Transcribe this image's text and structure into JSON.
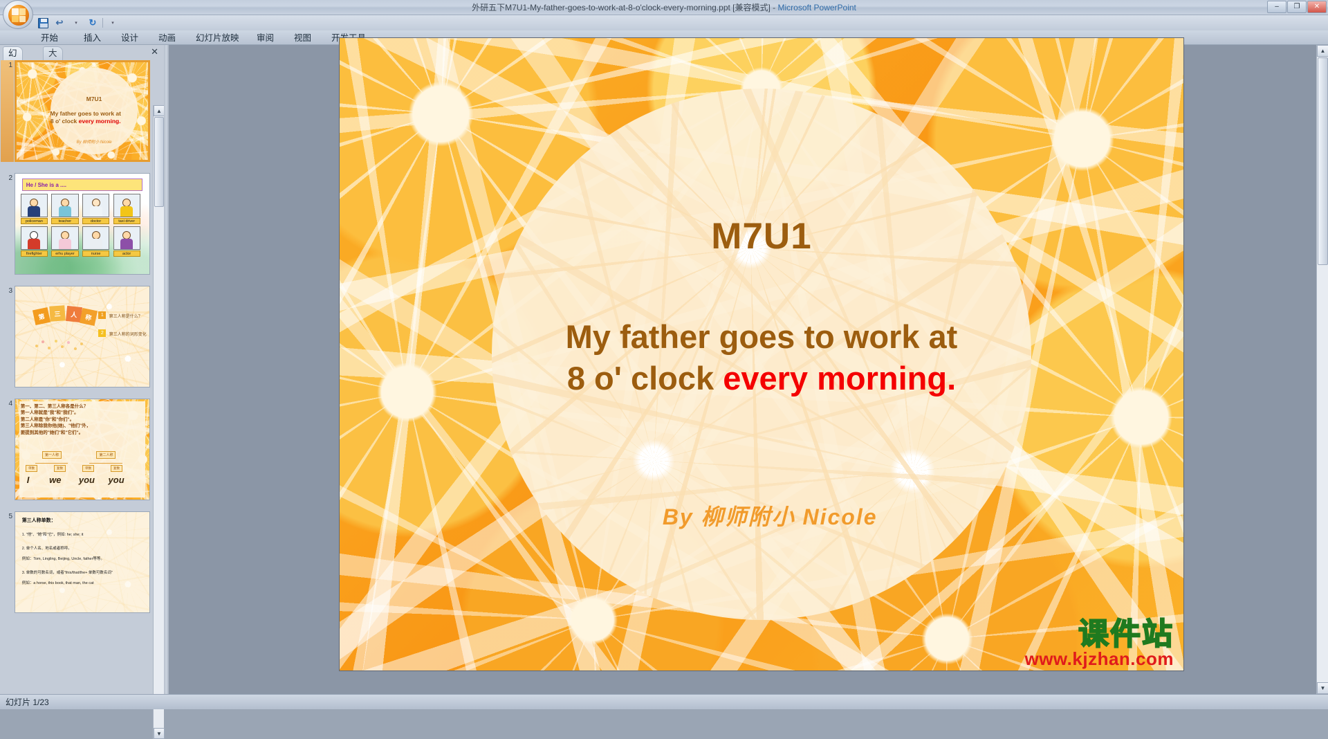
{
  "window": {
    "title": "外研五下M7U1-My-father-goes-to-work-at-8-o'clock-every-morning.ppt [兼容模式]",
    "separator": "  -  ",
    "app_name": "Microsoft PowerPoint",
    "minimize": "–",
    "restore": "❐",
    "close": "✕",
    "help": "?"
  },
  "quick_access": {
    "office_button": "office-orb",
    "save": "save-icon",
    "undo": "↩",
    "undo_caret": "▾",
    "redo": "↻",
    "customize_caret": "▾"
  },
  "ribbon": {
    "tabs": [
      {
        "label": "开始"
      },
      {
        "label": "插入"
      },
      {
        "label": "设计"
      },
      {
        "label": "动画"
      },
      {
        "label": "幻灯片放映"
      },
      {
        "label": "审阅"
      },
      {
        "label": "视图"
      },
      {
        "label": "开发工具"
      }
    ]
  },
  "left_pane": {
    "tabs": [
      {
        "label": "幻灯片",
        "active": true
      },
      {
        "label": "大纲",
        "active": false
      }
    ],
    "close_label": "✕",
    "slides": [
      {
        "number": "1",
        "selected": true,
        "title": "M7U1",
        "line1": "My father goes to work at",
        "line2_plain": "8 o' clock ",
        "line2_red": "every morning.",
        "signature": "By 柳师附小 Nicole"
      },
      {
        "number": "2",
        "selected": false,
        "banner": "He / She is a ....",
        "row1": [
          "policeman",
          "teacher",
          "doctor",
          "taxi driver"
        ],
        "row2": [
          "firefighter",
          "erhu player",
          "nurse",
          "actor"
        ]
      },
      {
        "number": "3",
        "selected": false,
        "tiles": [
          "第",
          "三",
          "人",
          "称"
        ],
        "items": [
          {
            "num": "1",
            "text": "第三人称是什么？"
          },
          {
            "num": "2",
            "text": "第三人称的词形变化"
          }
        ]
      },
      {
        "number": "4",
        "selected": false,
        "lines": [
          "第一、第二、第三人称各是什么？",
          "第一人称就是\"我\"和\"我们\"。",
          "第二人称是\"你\"和\"你们\"。",
          "第三人称除我你他(她)、\"他们\"外，",
          "要提到其他的\"她们\"和\"它们\"。"
        ],
        "node_left": "第一人称",
        "node_right": "第二人称",
        "sub_left": "单数",
        "sub_left2": "复数",
        "sub_right": "单数",
        "sub_right2": "复数",
        "words": [
          "I",
          "we",
          "you",
          "you"
        ]
      },
      {
        "number": "5",
        "selected": false,
        "heading": "第三人称单数：",
        "paras": [
          "1. \"他\"、\"她\"和\"它\"，例如: he; she; it",
          "2. 单个人名、地名或者称呼。",
          "   例如：Tom, Lingling, Beijing, Uncle, father等等。",
          "3. 单数的可数名词，或者\"this/that/the+ 单数可数名词\"",
          "   例如：a horse, this book, that man, the cat"
        ]
      }
    ]
  },
  "slide": {
    "title": "M7U1",
    "body_line1": "My father goes to work at",
    "body_line2_plain": "8 o' clock ",
    "body_line2_red": "every morning.",
    "signature": "By 柳师附小 Nicole",
    "colors": {
      "heading_brown": "#9c5d0f",
      "accent_red": "#f40000",
      "signature_orange": "#f19b2c",
      "circle_cream": "#fdf0d8",
      "background_orange": "#f9a01b"
    }
  },
  "watermark": {
    "site_name": "课件站",
    "site_url": "www.kjzhan.com"
  },
  "scrollbars": {
    "up_arrow": "▲",
    "down_arrow": "▼"
  },
  "status_bar": {
    "slide_counter": "幻灯片 1/23"
  }
}
